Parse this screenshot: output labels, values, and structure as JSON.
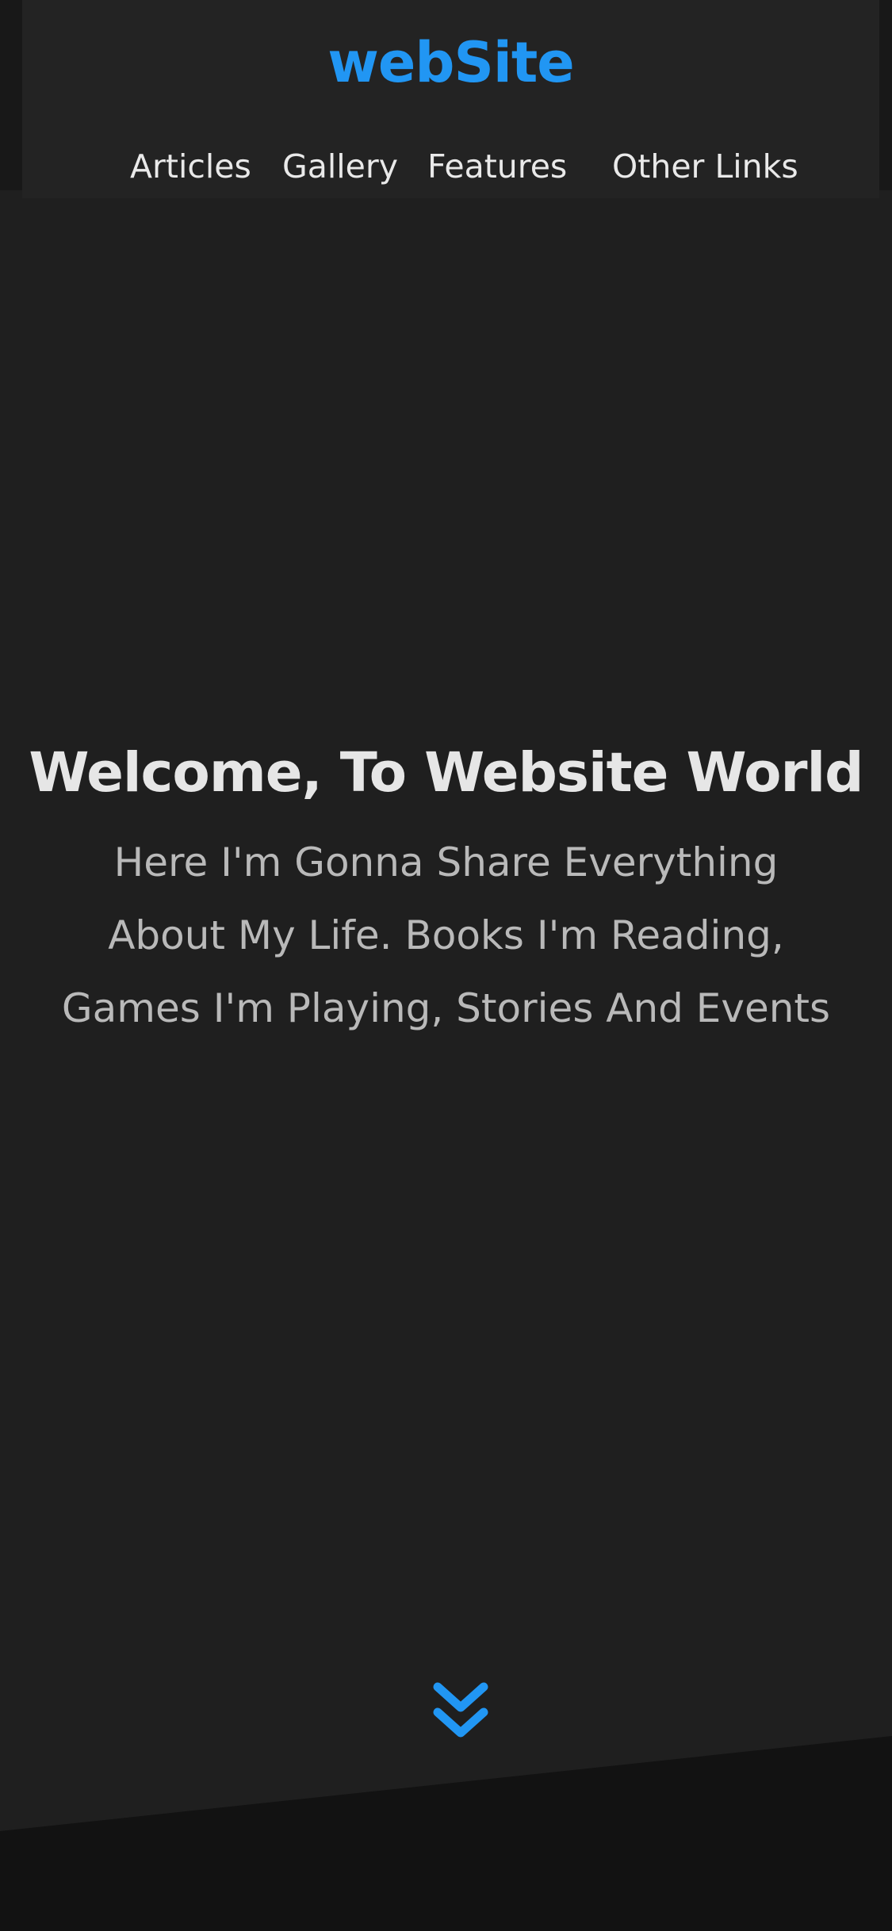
{
  "header": {
    "logo": "webSite",
    "nav": [
      "Articles",
      "Gallery",
      "Features",
      "Other Links"
    ]
  },
  "hero": {
    "title": "Welcome, To Website World",
    "description": "Here I'm Gonna Share Everything About My Life. Books I'm Reading, Games I'm Playing, Stories And Events"
  },
  "icons": {
    "scroll": "double-chevron-down-icon"
  },
  "colors": {
    "accent": "#2196f3",
    "background": "#1f1f1f",
    "header": "#232323",
    "footer_band": "#121212"
  }
}
